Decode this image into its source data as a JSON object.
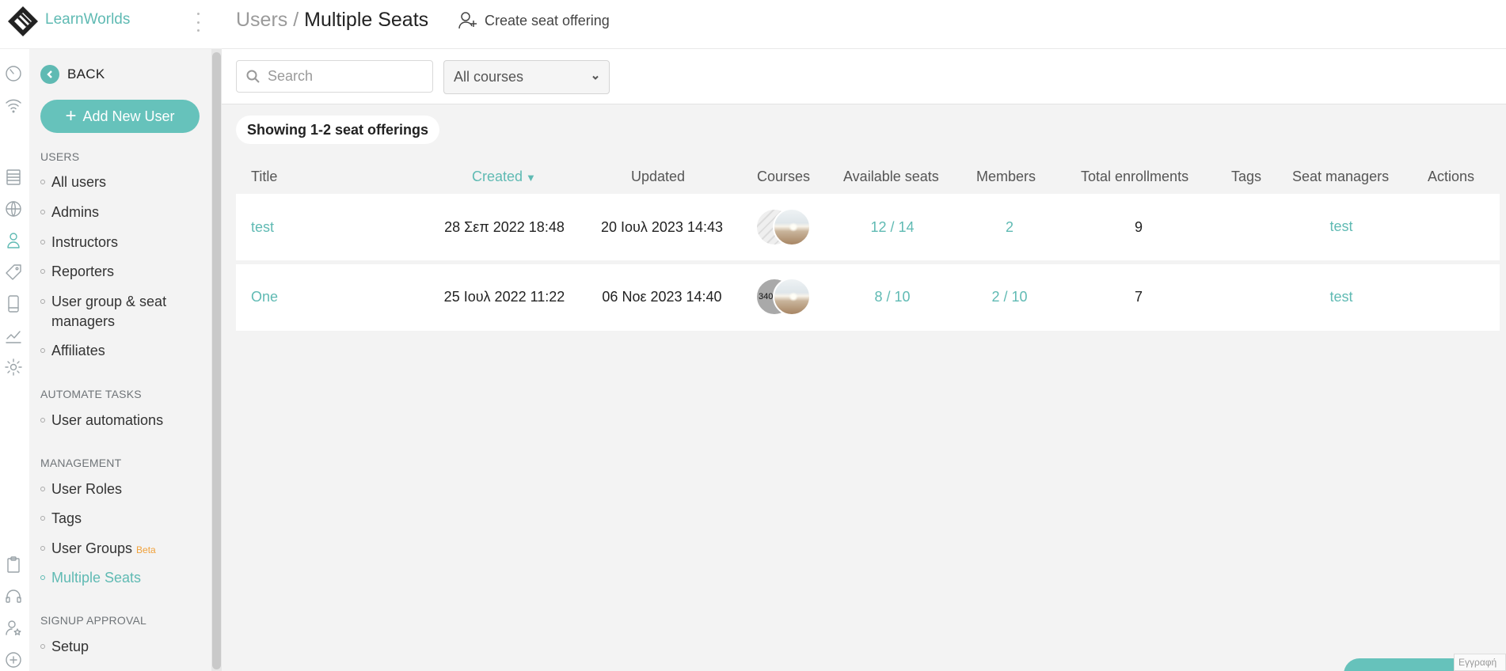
{
  "brand": {
    "name": "LearnWorlds"
  },
  "sidebar": {
    "back_label": "BACK",
    "add_user_label": "Add New User",
    "sections": {
      "users": "USERS",
      "automate": "AUTOMATE TASKS",
      "management": "MANAGEMENT",
      "signup": "SIGNUP APPROVAL"
    },
    "items": {
      "all_users": "All users",
      "admins": "Admins",
      "instructors": "Instructors",
      "reporters": "Reporters",
      "user_group_seat_managers_1": "User group & seat",
      "user_group_seat_managers_2": "managers",
      "affiliates": "Affiliates",
      "user_automations": "User automations",
      "user_roles": "User Roles",
      "tags": "Tags",
      "user_groups": "User Groups",
      "user_groups_badge": "Beta",
      "multiple_seats": "Multiple Seats",
      "setup": "Setup"
    }
  },
  "header": {
    "breadcrumb_parent": "Users /",
    "title": "Multiple Seats",
    "create_label": "Create seat offering"
  },
  "filters": {
    "search_placeholder": "Search",
    "course_select": "All courses"
  },
  "summary": "Showing 1-2 seat offerings",
  "table": {
    "columns": {
      "title": "Title",
      "created": "Created",
      "updated": "Updated",
      "courses": "Courses",
      "available": "Available seats",
      "members": "Members",
      "enrollments": "Total enrollments",
      "tags": "Tags",
      "managers": "Seat managers",
      "actions": "Actions"
    },
    "sort_arrow": "▼",
    "rows": [
      {
        "title": "test",
        "created": "28 Σεπ 2022 18:48",
        "updated": "20 Ιουλ 2023 14:43",
        "course_thumb_text": "",
        "available": "12 / 14",
        "members": "2",
        "enrollments": "9",
        "managers": "test"
      },
      {
        "title": "One",
        "created": "25 Ιουλ 2022 11:22",
        "updated": "06 Νοε 2023 14:40",
        "course_thumb_text": "340",
        "available": "8 / 10",
        "members": "2 / 10",
        "enrollments": "7",
        "managers": "test"
      }
    ]
  },
  "footer": {
    "language": "Εγγραφή"
  },
  "colors": {
    "accent": "#5fbab3",
    "beta": "#f0a13b"
  }
}
